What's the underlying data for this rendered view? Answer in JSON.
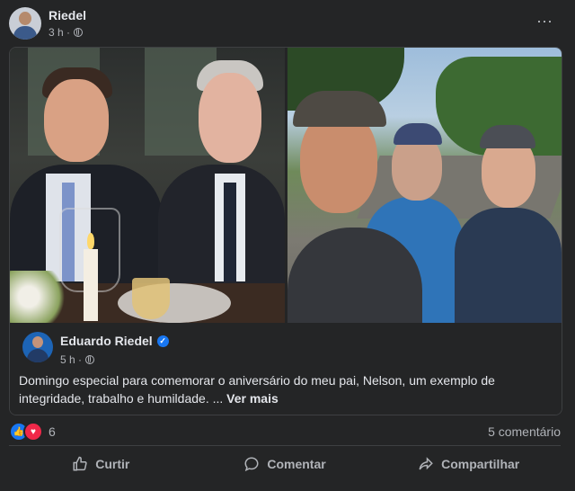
{
  "post": {
    "author": "Riedel",
    "time": "3 h ·",
    "more_icon": "⋯"
  },
  "shared_post": {
    "author": "Eduardo Riedel",
    "time": "5 h ·",
    "text": "Domingo especial para comemorar o aniversário do meu pai, Nelson, um exemplo de integridade, trabalho e humildade. ...",
    "see_more": "Ver mais"
  },
  "reactions": {
    "count": "6",
    "comments": "5 comentário"
  },
  "actions": {
    "like": "Curtir",
    "comment": "Comentar",
    "share": "Compartilhar"
  },
  "colors": {
    "background": "#242526",
    "like_blue": "#1877f2",
    "love_red": "#f02849"
  }
}
